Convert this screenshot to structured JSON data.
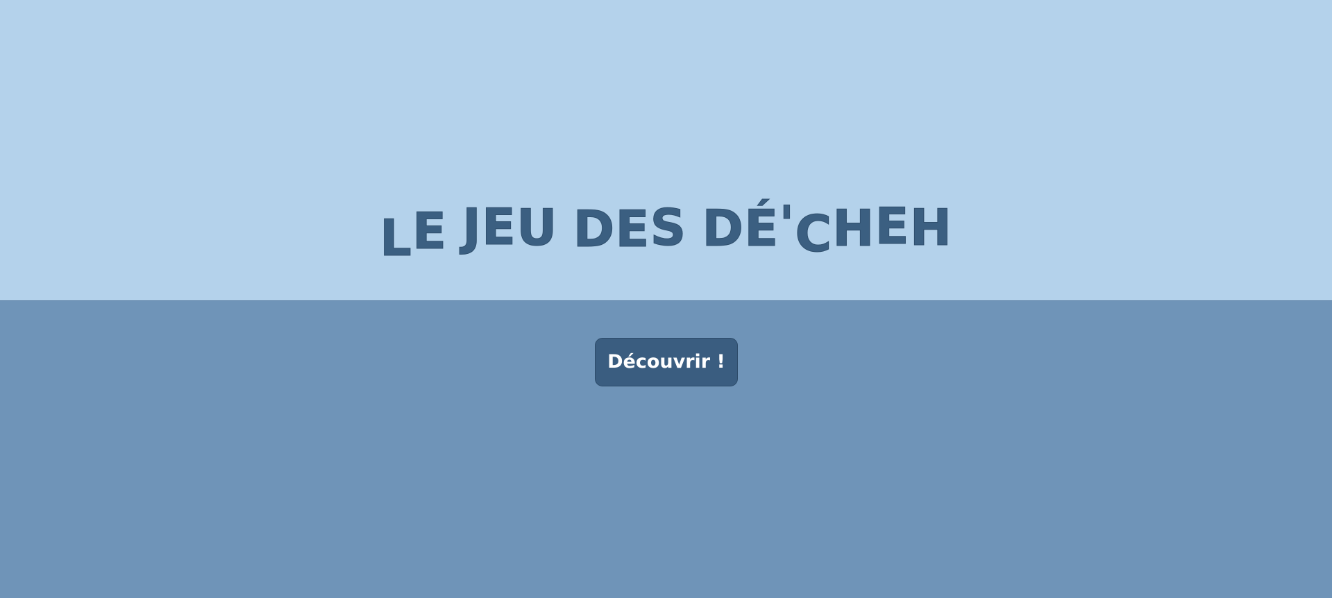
{
  "title": {
    "letters": [
      "L",
      "E",
      " ",
      "J",
      "E",
      "U",
      " ",
      "D",
      "E",
      "S",
      " ",
      "D",
      "É",
      "'",
      "C",
      "H",
      "E",
      "H"
    ],
    "text": "LE JEU DES DÉ'CHEH"
  },
  "cta": {
    "label": "Découvrir !"
  },
  "colors": {
    "top_band": "#b4d2eb",
    "bottom_band": "#6f94b8",
    "title_text": "#3b5f81",
    "button_bg": "#3a5d80",
    "button_text": "#ffffff"
  }
}
